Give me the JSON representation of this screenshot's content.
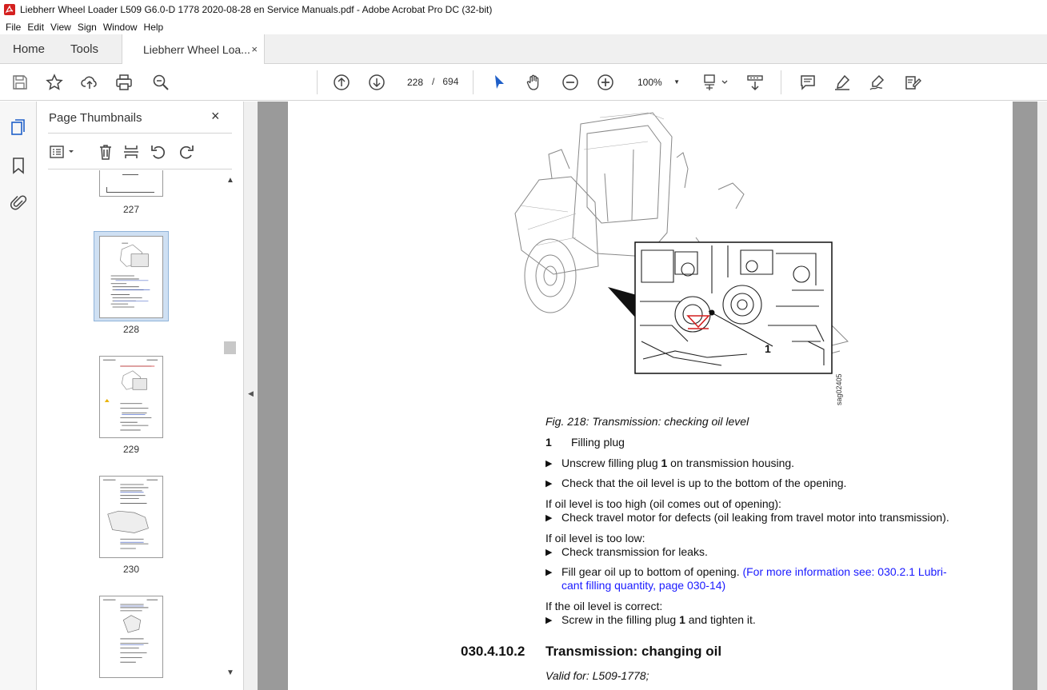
{
  "window": {
    "title": "Liebherr Wheel Loader L509 G6.0-D 1778 2020-08-28 en Service Manuals.pdf - Adobe Acrobat Pro DC (32-bit)"
  },
  "menu": [
    "File",
    "Edit",
    "View",
    "Sign",
    "Window",
    "Help"
  ],
  "tabs": {
    "home": "Home",
    "tools": "Tools",
    "document": "Liebherr Wheel Loa...",
    "close": "×"
  },
  "toolbar": {
    "current_page": "228",
    "page_separator": "/",
    "total_pages": "694",
    "zoom": "100%"
  },
  "thumbnails": {
    "title": "Page Thumbnails",
    "close": "×",
    "pages": [
      "227",
      "228",
      "229",
      "230"
    ],
    "selected": "228"
  },
  "document": {
    "figure_label": "1",
    "figure_id": "sag02405",
    "caption": "Fig. 218: Transmission: checking oil level",
    "legend": {
      "num": "1",
      "text": "Filling plug"
    },
    "step1_a": "Unscrew filling plug ",
    "step1_b": "1",
    "step1_c": " on transmission housing.",
    "step2": "Check that the oil level is up to the bottom of the opening.",
    "cond1": "If oil level is too high (oil comes out of opening):",
    "step3": "Check travel motor for defects (oil leaking from travel motor into transmission).",
    "cond2": "If oil level is too low:",
    "step4": "Check transmission for leaks.",
    "step5_a": "Fill gear oil up to bottom of opening. ",
    "step5_link1": "(For more information see: 030.2.1 Lubri-",
    "step5_link2": "cant filling quantity, page 030-14)",
    "cond3": "If the oil level is correct:",
    "step6_a": "Screw in the filling plug ",
    "step6_b": "1",
    "step6_c": " and tighten it.",
    "section_number": "030.4.10.2",
    "section_title": "Transmission: changing oil",
    "valid_for": "Valid for: L509-1778;"
  },
  "colors": {
    "link": "#1a1aff",
    "selection": "#cfe0f3",
    "acrobat_red": "#d4201f"
  }
}
